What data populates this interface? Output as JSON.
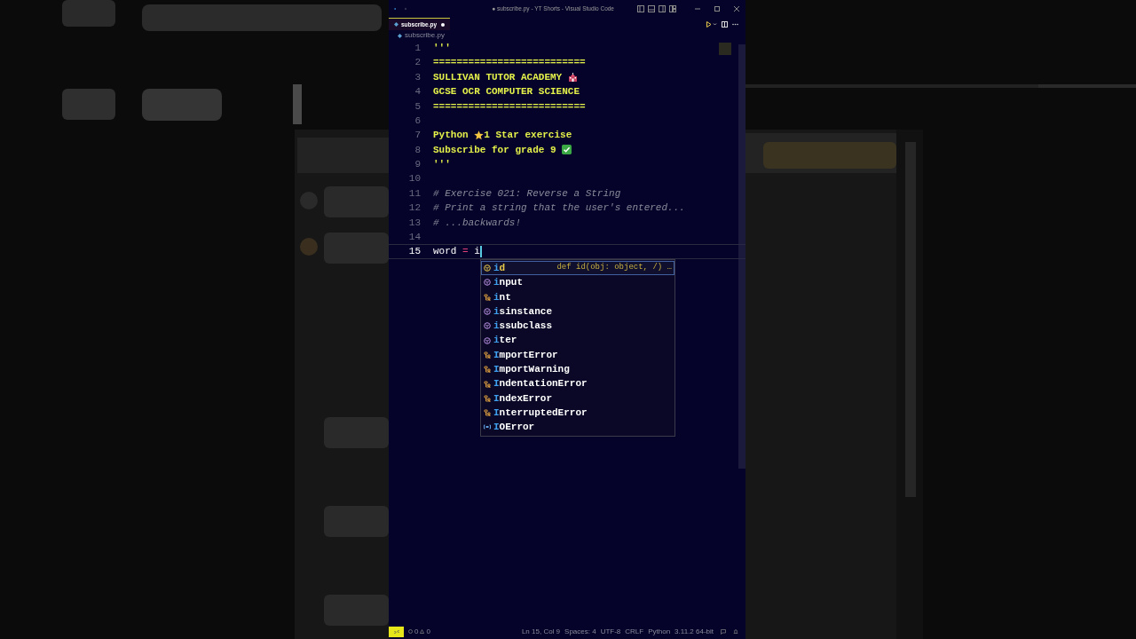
{
  "window": {
    "title": "● subscribe.py - YT Shorts - Visual Studio Code"
  },
  "tabs": [
    {
      "label": "subscribe.py",
      "selected": true,
      "modified": true
    }
  ],
  "breadcrumb": "subscribe.py",
  "editor": {
    "lines": [
      {
        "number": "1",
        "current": false,
        "segments": [
          {
            "kind": "docstring",
            "text": "'''"
          }
        ]
      },
      {
        "number": "2",
        "current": false,
        "segments": [
          {
            "kind": "docstring",
            "text": "=========================="
          }
        ]
      },
      {
        "number": "3",
        "current": false,
        "segments": [
          {
            "kind": "docstring",
            "text": "SULLIVAN TUTOR ACADEMY "
          },
          {
            "kind": "school"
          }
        ]
      },
      {
        "number": "4",
        "current": false,
        "segments": [
          {
            "kind": "docstring",
            "text": "GCSE OCR COMPUTER SCIENCE"
          }
        ]
      },
      {
        "number": "5",
        "current": false,
        "segments": [
          {
            "kind": "docstring",
            "text": "=========================="
          }
        ]
      },
      {
        "number": "6",
        "current": false
      },
      {
        "number": "7",
        "current": false,
        "segments": [
          {
            "kind": "docstring",
            "text": "Python "
          },
          {
            "kind": "star"
          },
          {
            "kind": "docstring",
            "text": "1 Star exercise"
          }
        ]
      },
      {
        "number": "8",
        "current": false,
        "segments": [
          {
            "kind": "docstring",
            "text": "Subscribe for grade 9 "
          },
          {
            "kind": "check"
          }
        ]
      },
      {
        "number": "9",
        "current": false,
        "segments": [
          {
            "kind": "docstring",
            "text": "'''"
          }
        ]
      },
      {
        "number": "10",
        "current": false
      },
      {
        "number": "11",
        "current": false,
        "segments": [
          {
            "kind": "comment",
            "text": "# Exercise 021: Reverse a String"
          }
        ]
      },
      {
        "number": "12",
        "current": false,
        "segments": [
          {
            "kind": "comment",
            "text": "# Print a string that the user's entered..."
          }
        ]
      },
      {
        "number": "13",
        "current": false,
        "segments": [
          {
            "kind": "comment",
            "text": "# ...backwards!"
          }
        ]
      },
      {
        "number": "14",
        "current": false
      },
      {
        "number": "15",
        "current": true,
        "segments": [
          {
            "kind": "name",
            "text": "word"
          },
          {
            "kind": "operator",
            "text": " = "
          },
          {
            "kind": "name",
            "text": "i"
          }
        ]
      }
    ]
  },
  "suggestions": [
    {
      "match": "i",
      "rest": "d",
      "kind": "function",
      "selected": true,
      "detail": "def id(obj: object, /) …"
    },
    {
      "match": "i",
      "rest": "nput",
      "kind": "function",
      "selected": false
    },
    {
      "match": "i",
      "rest": "nt",
      "kind": "class",
      "selected": false
    },
    {
      "match": "i",
      "rest": "sinstance",
      "kind": "function",
      "selected": false
    },
    {
      "match": "i",
      "rest": "ssubclass",
      "kind": "function",
      "selected": false
    },
    {
      "match": "i",
      "rest": "ter",
      "kind": "function",
      "selected": false
    },
    {
      "match": "I",
      "rest": "mportError",
      "kind": "class",
      "selected": false
    },
    {
      "match": "I",
      "rest": "mportWarning",
      "kind": "class",
      "selected": false
    },
    {
      "match": "I",
      "rest": "ndentationError",
      "kind": "class",
      "selected": false
    },
    {
      "match": "I",
      "rest": "ndexError",
      "kind": "class",
      "selected": false
    },
    {
      "match": "I",
      "rest": "nterruptedError",
      "kind": "class",
      "selected": false
    },
    {
      "match": "I",
      "rest": "OError",
      "kind": "variable",
      "selected": false
    }
  ],
  "status_bar": {
    "errors": "0",
    "warnings": "0",
    "items": [
      "Ln 15, Col 9",
      "Spaces: 4",
      "UTF-8",
      "CRLF",
      "Python",
      "3.11.2 64-bit"
    ]
  }
}
